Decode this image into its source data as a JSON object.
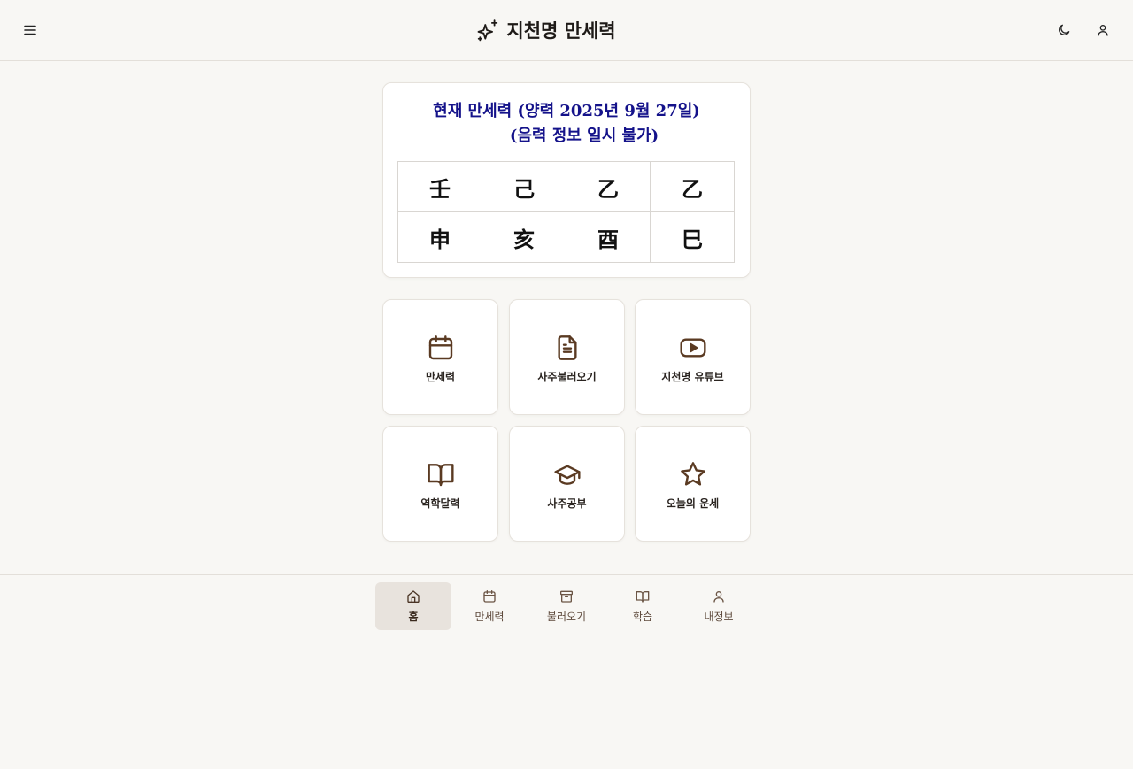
{
  "header": {
    "title": "지천명 만세력",
    "brand_icon": "sparkles-icon",
    "left_icon": "menu-icon",
    "right_icons": [
      "moon-icon",
      "user-icon"
    ]
  },
  "pillar_card": {
    "heading_line1": "현재 만세력 (양력 2025년 9월 27일)",
    "heading_line2": "(음력 정보 일시 불가)",
    "heading_color": "#14128a",
    "stems": [
      "壬",
      "己",
      "乙",
      "乙"
    ],
    "branches": [
      "申",
      "亥",
      "酉",
      "巳"
    ]
  },
  "tiles": [
    {
      "label": "만세력",
      "icon": "calendar-icon"
    },
    {
      "label": "사주불러오기",
      "icon": "document-icon"
    },
    {
      "label": "지천명 유튜브",
      "icon": "youtube-icon"
    },
    {
      "label": "역학달력",
      "icon": "book-open-icon"
    },
    {
      "label": "사주공부",
      "icon": "graduation-cap-icon"
    },
    {
      "label": "오늘의 운세",
      "icon": "star-icon"
    }
  ],
  "accent_color": "#5a3a22",
  "bottom_nav": {
    "active": "홈",
    "items": [
      {
        "label": "홈",
        "icon": "home-icon"
      },
      {
        "label": "만세력",
        "icon": "calendar-icon"
      },
      {
        "label": "불러오기",
        "icon": "archive-icon"
      },
      {
        "label": "학습",
        "icon": "book-open-icon"
      },
      {
        "label": "내정보",
        "icon": "user-icon"
      }
    ]
  }
}
